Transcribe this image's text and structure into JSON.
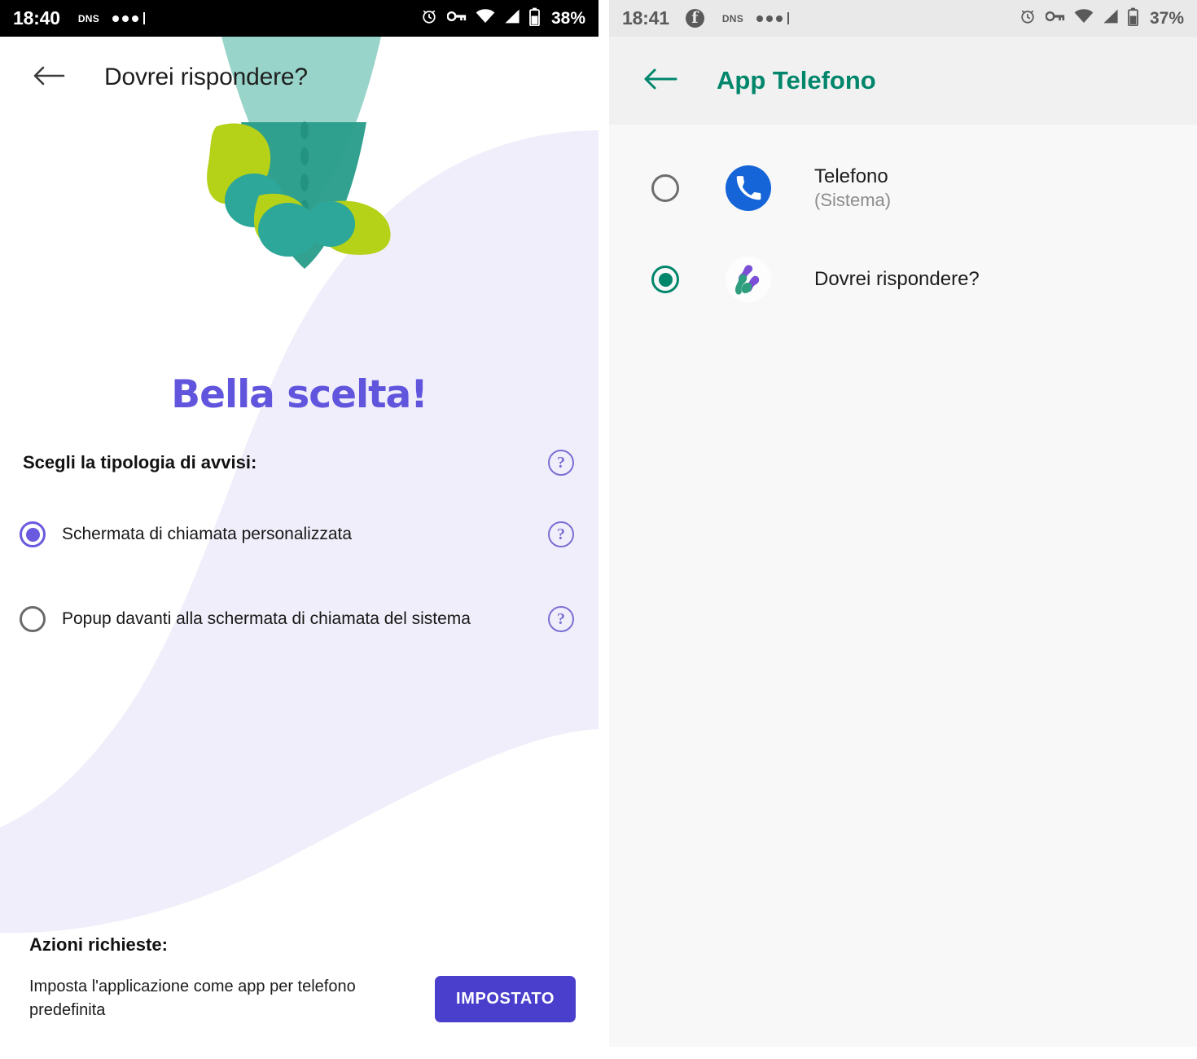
{
  "left_screen": {
    "status_bar": {
      "time": "18:40",
      "dns_label": "DNS",
      "battery_percent": "38%",
      "icons": [
        "alarm-clock-icon",
        "vpn-key-icon",
        "wifi-icon",
        "cell-signal-icon",
        "battery-icon"
      ]
    },
    "app_bar": {
      "back_icon": "back-arrow-icon",
      "title": "Dovrei rispondere?"
    },
    "hero_title": "Bella scelta!",
    "section_label": "Scegli la tipologia di avvisi:",
    "help_glyph": "?",
    "options": [
      {
        "label": "Schermata di chiamata personalizzata",
        "selected": true
      },
      {
        "label": "Popup davanti alla schermata di chiamata del sistema",
        "selected": false
      }
    ],
    "actions": {
      "title": "Azioni richieste:",
      "description": "Imposta l'applicazione come app per telefono predefinita",
      "button_label": "IMPOSTATO"
    },
    "colors": {
      "accent_purple": "#6155dd",
      "button_purple": "#4a3fcc",
      "radio_purple": "#6a5ae0",
      "help_purple": "#7a6fd4",
      "background_blob": "#f0eefa",
      "illustration_teal": "#2a9d8a",
      "illustration_light_teal": "#8fd0c4",
      "illustration_green": "#b5d118"
    }
  },
  "right_screen": {
    "status_bar": {
      "time": "18:41",
      "facebook_icon": "facebook-icon",
      "facebook_glyph": "f",
      "dns_label": "DNS",
      "battery_percent": "37%",
      "icons": [
        "alarm-clock-icon",
        "vpn-key-icon",
        "wifi-icon",
        "cell-signal-icon",
        "battery-icon"
      ]
    },
    "app_bar": {
      "back_icon": "back-arrow-icon",
      "title": "App Telefono"
    },
    "apps": [
      {
        "name": "Telefono",
        "subtitle": "(Sistema)",
        "selected": false,
        "icon": "phone-handset-icon"
      },
      {
        "name": "Dovrei rispondere?",
        "subtitle": "",
        "selected": true,
        "icon": "dovrei-rispondere-app-icon"
      }
    ],
    "colors": {
      "accent_teal": "#00866b",
      "phone_icon_blue": "#1565d8",
      "status_bar_bg": "#e9e9e9",
      "page_bg": "#f8f8f8"
    }
  }
}
